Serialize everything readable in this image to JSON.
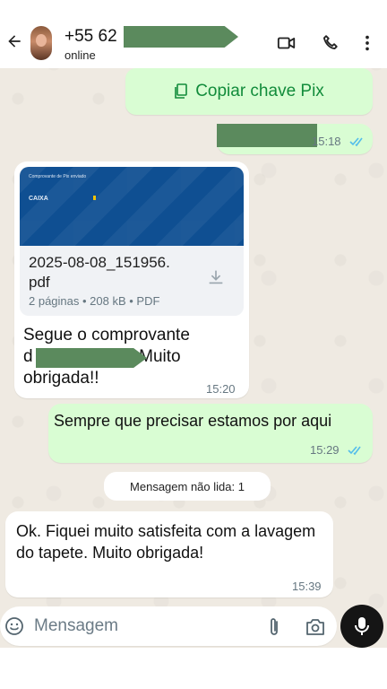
{
  "header": {
    "title": "+55 62",
    "status": "online"
  },
  "messages": {
    "pix_button": "Copiar chave Pix",
    "pix_time": "15:18",
    "document": {
      "thumb_title": "Comprovante de Pix enviado",
      "thumb_brand": "CAIXA",
      "filename_line1": "2025-08-08_151956.",
      "filename_line2": "pdf",
      "meta": "2 páginas • 208 kB • PDF",
      "caption_line1": "Segue o comprovante",
      "caption_line2_prefix": "d",
      "caption_line2_suffix": ". Muito",
      "caption_line3": "obrigada!!",
      "time": "15:20"
    },
    "outgoing_2": {
      "text": "Sempre que precisar estamos por aqui",
      "time": "15:29"
    },
    "unread_label": "Mensagem não lida: 1",
    "incoming_2": {
      "text": "Ok. Fiquei muito satisfeita com a lavagem do tapete. Muito obrigada!",
      "time": "15:39"
    }
  },
  "input": {
    "placeholder": "Mensagem"
  },
  "colors": {
    "outgoing_bubble": "#d9fdd3",
    "incoming_bubble": "#ffffff",
    "accent_green": "#128c3b",
    "read_ticks": "#53bdeb",
    "redaction": "#5b8a5d"
  },
  "icons": [
    "back-arrow-icon",
    "video-call-icon",
    "phone-icon",
    "more-vert-icon",
    "copy-icon",
    "double-check-icon",
    "download-icon",
    "emoji-icon",
    "attach-icon",
    "camera-icon",
    "mic-icon"
  ]
}
